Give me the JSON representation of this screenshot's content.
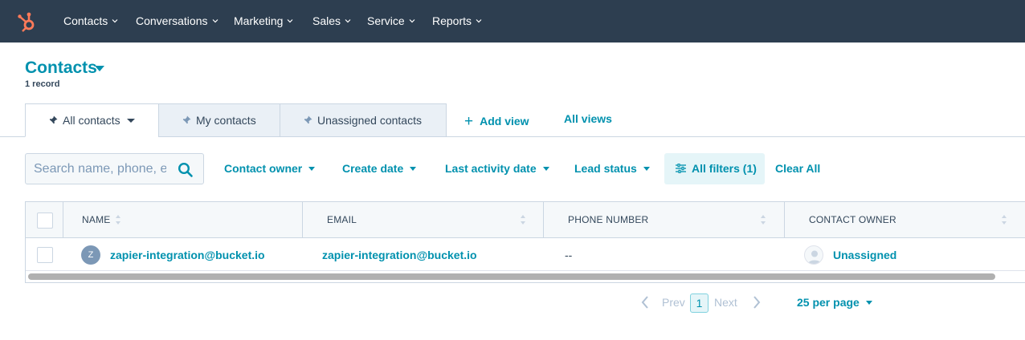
{
  "nav": {
    "items": [
      {
        "label": "Contacts"
      },
      {
        "label": "Conversations"
      },
      {
        "label": "Marketing"
      },
      {
        "label": "Sales"
      },
      {
        "label": "Service"
      },
      {
        "label": "Reports"
      }
    ]
  },
  "header": {
    "title": "Contacts",
    "record_count": "1 record"
  },
  "views": {
    "tabs": [
      {
        "label": "All contacts",
        "active": true
      },
      {
        "label": "My contacts",
        "active": false
      },
      {
        "label": "Unassigned contacts",
        "active": false
      }
    ],
    "add_view": "Add view",
    "all_views": "All views"
  },
  "filters": {
    "search_placeholder": "Search name, phone, email",
    "dropdowns": [
      {
        "label": "Contact owner"
      },
      {
        "label": "Create date"
      },
      {
        "label": "Last activity date"
      },
      {
        "label": "Lead status"
      }
    ],
    "all_filters": "All filters (1)",
    "clear_all": "Clear All"
  },
  "table": {
    "columns": [
      "NAME",
      "EMAIL",
      "PHONE NUMBER",
      "CONTACT OWNER"
    ],
    "rows": [
      {
        "avatar_initial": "Z",
        "name": "zapier-integration@bucket.io",
        "email": "zapier-integration@bucket.io",
        "phone": "--",
        "owner": "Unassigned"
      }
    ]
  },
  "pagination": {
    "prev": "Prev",
    "current_page": "1",
    "next": "Next",
    "per_page": "25 per page"
  },
  "colors": {
    "nav_bg": "#2d3e50",
    "accent": "#0091ae",
    "brand_orange": "#ff7a59",
    "text": "#33475b",
    "border": "#cbd6e2"
  }
}
